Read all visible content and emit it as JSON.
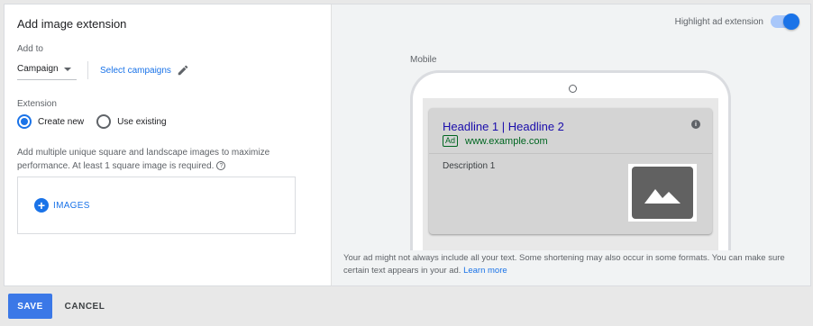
{
  "panel": {
    "title": "Add image extension",
    "add_to_label": "Add to",
    "add_to_value": "Campaign",
    "select_campaigns": "Select campaigns",
    "extension_label": "Extension",
    "radio_create_new": "Create new",
    "radio_use_existing": "Use existing",
    "selected_option": "Create new",
    "help_text": "Add multiple unique square and landscape images to maximize performance. At least 1 square image is required.",
    "images_button": "IMAGES"
  },
  "preview": {
    "highlight_label": "Highlight ad extension",
    "highlight_on": true,
    "mobile_label": "Mobile",
    "ad": {
      "headline": "Headline 1 | Headline 2",
      "badge": "Ad",
      "url": "www.example.com",
      "description": "Description 1"
    },
    "note_text": "Your ad might not always include all your text. Some shortening may also occur in some formats. You can make sure certain text appears in your ad.",
    "note_link": "Learn more"
  },
  "footer": {
    "save": "SAVE",
    "cancel": "CANCEL"
  },
  "colors": {
    "accent": "#1a73e8",
    "save_button": "#3b78e7",
    "ad_url_green": "#006621",
    "headline_blue": "#1a0dab"
  },
  "icons": {
    "dropdown": "caret-down-icon",
    "edit": "pencil-icon",
    "help": "question-circle-icon",
    "add": "plus-circle-icon",
    "info": "info-icon",
    "image_placeholder": "mountain-image-icon"
  }
}
